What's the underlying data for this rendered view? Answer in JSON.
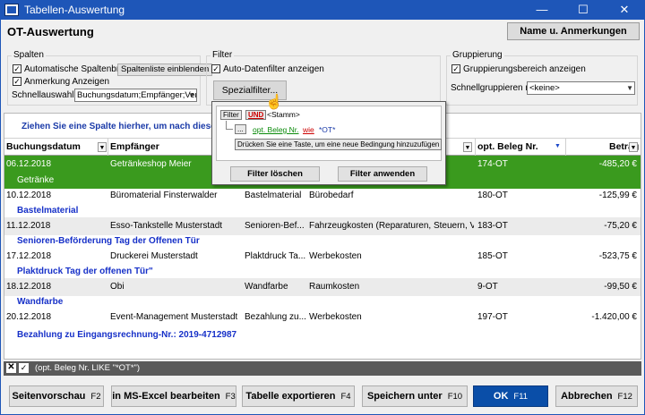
{
  "window": {
    "title": "Tabellen-Auswertung",
    "minimize_glyph": "—",
    "maximize_glyph": "☐",
    "close_glyph": "✕"
  },
  "page_title": "OT-Auswertung",
  "name_button": "Name u. Anmerkungen",
  "spalten": {
    "legend": "Spalten",
    "auto_width": "Automatische Spaltenbreite",
    "show_note": "Anmerkung Anzeigen",
    "column_list_button": "Spaltenliste einblenden",
    "quick_select_label": "Schnellauswahl:",
    "quick_select_value": "Buchungsdatum;Empfänger;Verwendu"
  },
  "filter": {
    "legend": "Filter",
    "auto_filter": "Auto-Datenfilter anzeigen",
    "special_button": "Spezialfilter..."
  },
  "gruppierung": {
    "legend": "Gruppierung",
    "show_area": "Gruppierungsbereich anzeigen",
    "quick_group_label": "Schnellgruppieren nach:",
    "quick_group_value": "<keine>"
  },
  "grid": {
    "group_hint": "Ziehen Sie eine Spalte hierher, um nach dieser Spa",
    "columns": [
      "Buchungsdatum",
      "Empfänger",
      "opt. Beleg Nr.",
      "Betrag"
    ],
    "rows": [
      {
        "date": "06.12.2018",
        "recipient": "Getränkeshop Meier",
        "purpose": "",
        "category": "",
        "beleg": "174-OT",
        "amount": "-485,20 €",
        "note": "Getränke"
      },
      {
        "date": "10.12.2018",
        "recipient": "Büromaterial Finsterwalder",
        "purpose": "Bastelmaterial",
        "category": "Bürobedarf",
        "beleg": "180-OT",
        "amount": "-125,99 €",
        "note": "Bastelmaterial"
      },
      {
        "date": "11.12.2018",
        "recipient": "Esso-Tankstelle Musterstadt",
        "purpose": "Senioren-Bef...",
        "category": "Fahrzeugkosten (Reparaturen, Steuern, Ve...",
        "beleg": "183-OT",
        "amount": "-75,20 €",
        "note": "Senioren-Beförderung Tag der Offenen Tür"
      },
      {
        "date": "17.12.2018",
        "recipient": "Druckerei Musterstadt",
        "purpose": "Plaktdruck Ta...",
        "category": "Werbekosten",
        "beleg": "185-OT",
        "amount": "-523,75 €",
        "note": "Plaktdruck Tag der offenen Tür\""
      },
      {
        "date": "18.12.2018",
        "recipient": "Obi",
        "purpose": "Wandfarbe",
        "category": "Raumkosten",
        "beleg": "9-OT",
        "amount": "-99,50 €",
        "note": "Wandfarbe"
      },
      {
        "date": "20.12.2018",
        "recipient": "Event-Management Musterstadt",
        "purpose": "Bezahlung zu...",
        "category": "Werbekosten",
        "beleg": "197-OT",
        "amount": "-1.420,00 €",
        "note": "Bezahlung zu Eingangsrechnung-Nr.: 2019-4712987"
      }
    ]
  },
  "filter_status": "(opt. Beleg Nr. LIKE \"*OT*\")",
  "popup": {
    "filter_tab": "Filter",
    "und": "UND",
    "root_suffix": "<Stamm>",
    "ellipsis": "...",
    "field": "opt. Beleg Nr.",
    "op": "wie",
    "value": "*OT*",
    "hint": "Drücken Sie eine Taste, um eine neue Bedingung hinzuzufügen",
    "clear": "Filter löschen",
    "apply": "Filter anwenden"
  },
  "buttons": [
    {
      "label": "Seitenvorschau",
      "key": "F2"
    },
    {
      "label": "in MS-Excel bearbeiten",
      "key": "F3"
    },
    {
      "label": "Tabelle exportieren",
      "key": "F4"
    },
    {
      "label": "Speichern unter",
      "key": "F10"
    },
    {
      "label": "OK",
      "key": "F11"
    },
    {
      "label": "Abbrechen",
      "key": "F12"
    }
  ],
  "colors": {
    "titlebar": "#1e56b8",
    "selected_row": "#3a9a1e",
    "note_text": "#1630c8",
    "primary_button": "#0a4ea8"
  }
}
